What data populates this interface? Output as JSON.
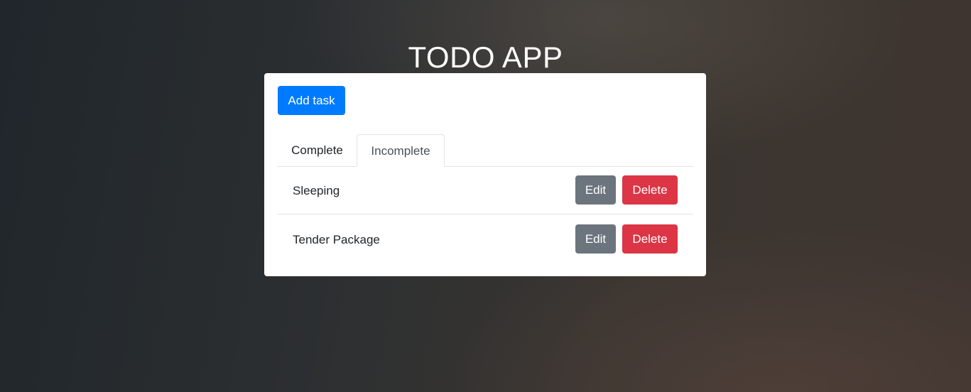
{
  "app": {
    "title": "TODO APP"
  },
  "toolbar": {
    "add_label": "Add task"
  },
  "tabs": [
    {
      "label": "Complete",
      "active": false
    },
    {
      "label": "Incomplete",
      "active": true
    }
  ],
  "tasks": [
    {
      "name": "Sleeping",
      "edit_label": "Edit",
      "delete_label": "Delete"
    },
    {
      "name": "Tender Package",
      "edit_label": "Edit",
      "delete_label": "Delete"
    }
  ],
  "colors": {
    "primary": "#007bff",
    "secondary": "#6c757d",
    "danger": "#dc3545"
  }
}
